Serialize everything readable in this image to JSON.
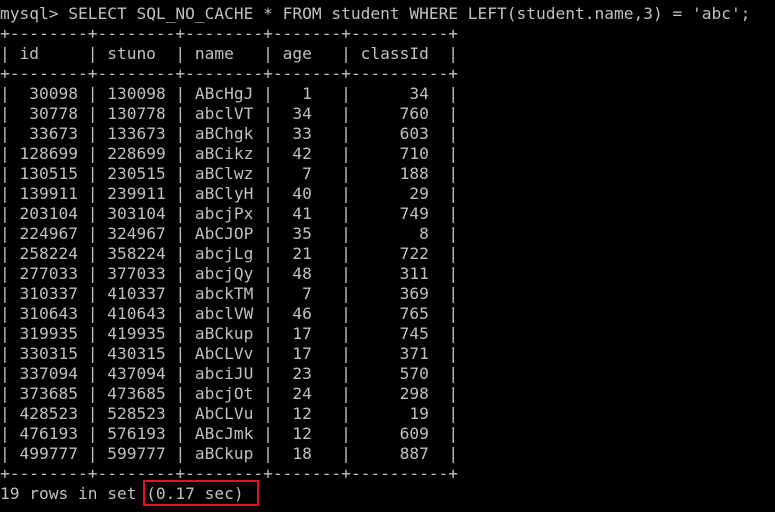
{
  "terminal": {
    "prompt": "mysql>",
    "command": " SELECT SQL_NO_CACHE * FROM student WHERE LEFT(student.name,3) = 'abc';"
  },
  "table": {
    "separator": "+--------+--------+--------+-------+----------+",
    "columns": [
      "id",
      "stuno",
      "name",
      "age",
      "classId"
    ],
    "header_line": "| id     | stuno  | name   | age   | classId  |",
    "rows": [
      [
        "30098",
        "130098",
        "ABcHgJ",
        "1",
        "34"
      ],
      [
        "30778",
        "130778",
        "abclVT",
        "34",
        "760"
      ],
      [
        "33673",
        "133673",
        "aBChgk",
        "33",
        "603"
      ],
      [
        "128699",
        "228699",
        "aBCikz",
        "42",
        "710"
      ],
      [
        "130515",
        "230515",
        "aBClwz",
        "7",
        "188"
      ],
      [
        "139911",
        "239911",
        "aBClyH",
        "40",
        "29"
      ],
      [
        "203104",
        "303104",
        "abcjPx",
        "41",
        "749"
      ],
      [
        "224967",
        "324967",
        "AbCJOP",
        "35",
        "8"
      ],
      [
        "258224",
        "358224",
        "abcjLg",
        "21",
        "722"
      ],
      [
        "277033",
        "377033",
        "abcjQy",
        "48",
        "311"
      ],
      [
        "310337",
        "410337",
        "abckTM",
        "7",
        "369"
      ],
      [
        "310643",
        "410643",
        "abclVW",
        "46",
        "765"
      ],
      [
        "319935",
        "419935",
        "aBCkup",
        "17",
        "745"
      ],
      [
        "330315",
        "430315",
        "AbCLVv",
        "17",
        "371"
      ],
      [
        "337094",
        "437094",
        "abciJU",
        "23",
        "570"
      ],
      [
        "373685",
        "473685",
        "abcjOt",
        "24",
        "298"
      ],
      [
        "428523",
        "528523",
        "AbCLVu",
        "12",
        "19"
      ],
      [
        "476193",
        "576193",
        "ABcJmk",
        "12",
        "609"
      ],
      [
        "499777",
        "599777",
        "aBCkup",
        "18",
        "887"
      ]
    ]
  },
  "result": {
    "summary": "19 rows in set ",
    "timing": "(0.17 sec)"
  },
  "colors": {
    "background": "#000000",
    "text": "#c0c0c0",
    "highlight": "#e81123"
  }
}
